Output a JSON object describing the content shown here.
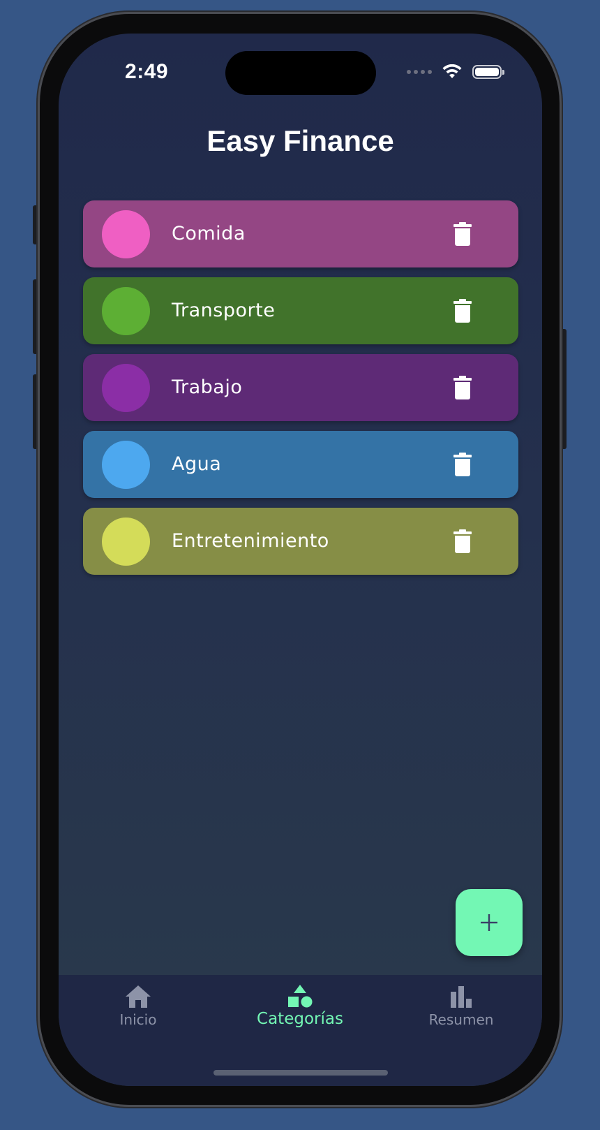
{
  "status_bar": {
    "time": "2:49",
    "icons": [
      "signal-dots-icon",
      "wifi-icon",
      "battery-icon"
    ]
  },
  "app": {
    "title": "Easy Finance"
  },
  "categories": [
    {
      "label": "Comida",
      "swatch_color": "#ef5fc3",
      "card_color": "#944684",
      "action_icon": "trash-icon"
    },
    {
      "label": "Transporte",
      "swatch_color": "#5daf34",
      "card_color": "#41732b",
      "action_icon": "trash-icon"
    },
    {
      "label": "Trabajo",
      "swatch_color": "#8b2ea6",
      "card_color": "#5e2a76",
      "action_icon": "trash-icon"
    },
    {
      "label": "Agua",
      "swatch_color": "#4da8ef",
      "card_color": "#3473a6",
      "action_icon": "trash-icon"
    },
    {
      "label": "Entretenimiento",
      "swatch_color": "#d4dc59",
      "card_color": "#868e46",
      "action_icon": "trash-icon"
    }
  ],
  "fab": {
    "icon": "plus-icon",
    "color": "#73f7b4"
  },
  "bottom_nav": {
    "items": [
      {
        "label": "Inicio",
        "icon": "home-icon",
        "active": false
      },
      {
        "label": "Categorías",
        "icon": "shapes-icon",
        "active": true
      },
      {
        "label": "Resumen",
        "icon": "bar-chart-icon",
        "active": false
      }
    ],
    "active_color": "#73f7b4",
    "inactive_color": "#8d93a8"
  }
}
